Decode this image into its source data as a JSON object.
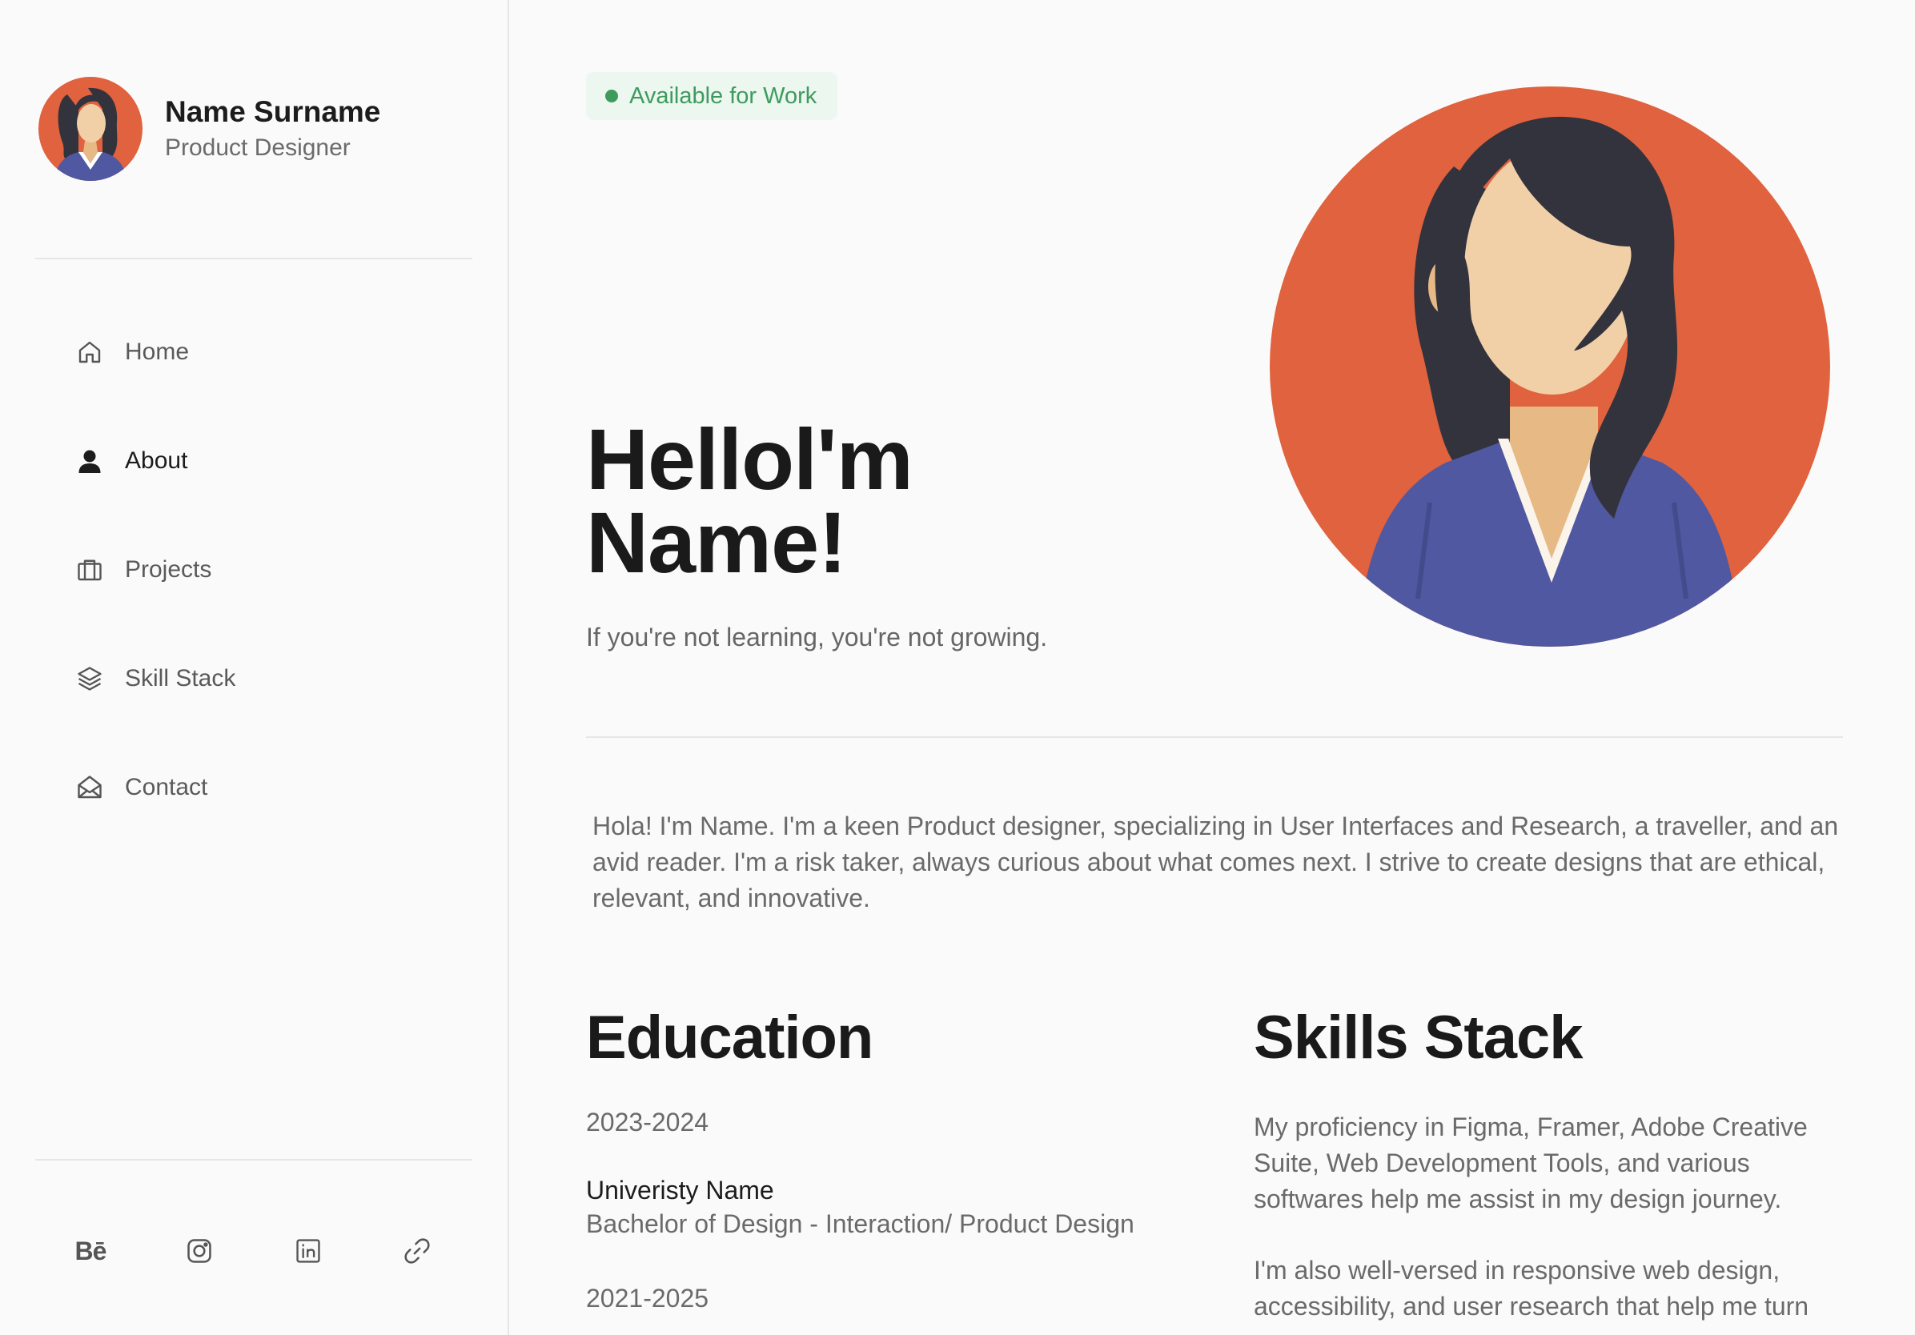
{
  "sidebar": {
    "profile": {
      "name": "Name Surname",
      "role": "Product Designer"
    },
    "nav": [
      {
        "label": "Home",
        "icon": "home-icon"
      },
      {
        "label": "About",
        "icon": "user-icon",
        "active": true
      },
      {
        "label": "Projects",
        "icon": "briefcase-icon"
      },
      {
        "label": "Skill Stack",
        "icon": "layers-icon"
      },
      {
        "label": "Contact",
        "icon": "envelope-open-icon"
      }
    ],
    "socials": [
      {
        "name": "behance",
        "icon": "behance-icon",
        "text": "Bē"
      },
      {
        "name": "instagram",
        "icon": "instagram-icon"
      },
      {
        "name": "linkedin",
        "icon": "linkedin-icon"
      },
      {
        "name": "link",
        "icon": "link-icon"
      }
    ]
  },
  "main": {
    "badge": "Available for Work",
    "hero_title_line1": "Hellol'm",
    "hero_title_line2": "Name!",
    "hero_subtitle": "If you're not learning, you're not growing.",
    "bio": "Hola! I'm Name. I'm a keen Product designer, specializing in User Interfaces and Research, a traveller, and an avid reader. I'm a risk taker, always curious about what comes next. I strive to create designs that are ethical, relevant, and innovative.",
    "education": {
      "title": "Education",
      "entries": [
        {
          "years": "2023-2024",
          "school": "Univeristy Name",
          "degree": "Bachelor of Design - Interaction/ Product Design"
        },
        {
          "years": "2021-2025"
        }
      ]
    },
    "skills": {
      "title": "Skills Stack",
      "p1": "My proficiency in Figma, Framer, Adobe Creative Suite, Web Development Tools, and various softwares help me assist in my design journey.",
      "p2": "I'm also well-versed in responsive web design, accessibility, and user research that help me turn"
    }
  },
  "colors": {
    "accent_green": "#3e9b5e",
    "badge_bg": "#ecf7ef",
    "portrait_bg": "#e0623e",
    "shirt": "#4f58a0",
    "hair": "#33333d",
    "skin": "#f1d0a8"
  }
}
